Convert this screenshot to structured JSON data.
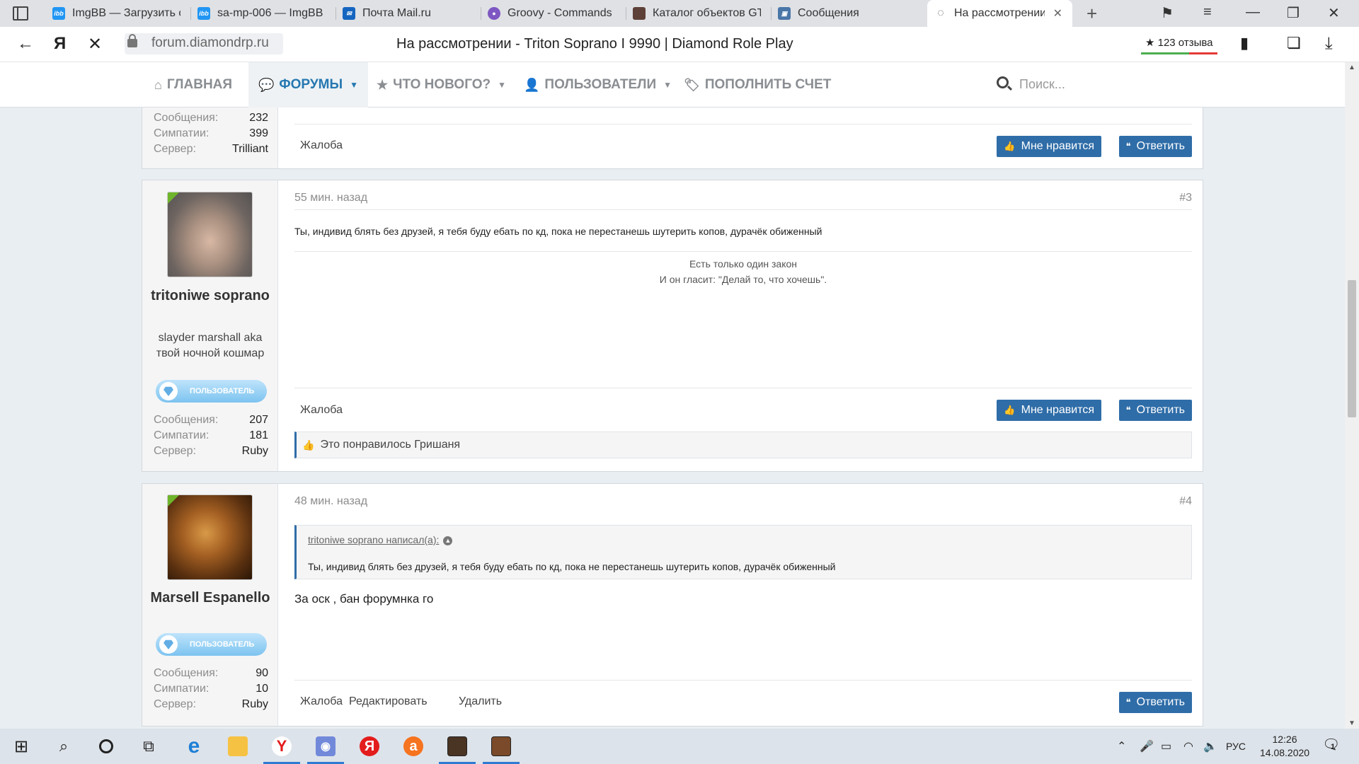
{
  "browser": {
    "tabs": [
      {
        "title": "ImgBB — Загрузить с",
        "icon": "imgbb-icon",
        "color": "#2196f3",
        "short": "ibb"
      },
      {
        "title": "sa-mp-006 — ImgBB",
        "icon": "imgbb-icon",
        "color": "#2196f3",
        "short": "ibb"
      },
      {
        "title": "Почта Mail.ru",
        "icon": "mail-icon",
        "color": "#1565c0",
        "short": "✉"
      },
      {
        "title": "Groovy - Commands",
        "icon": "discord-icon",
        "color": "#7e57c2",
        "short": "●"
      },
      {
        "title": "Каталог объектов GT",
        "icon": "catalog-icon",
        "color": "#5d4037",
        "short": ""
      },
      {
        "title": "Сообщения",
        "icon": "vk-icon",
        "color": "#4a76a8",
        "short": "▣"
      },
      {
        "title": "На рассмотрении",
        "icon": "loading-icon",
        "color": "#ffffff",
        "short": "◌"
      }
    ],
    "url": "forum.diamondrp.ru",
    "page_title": "На рассмотрении - Triton Soprano I 9990 | Diamond Role Play",
    "reviews": "★ 123 отзыва"
  },
  "nav": {
    "home": "ГЛАВНАЯ",
    "forums": "ФОРУМЫ",
    "whats_new": "ЧТО НОВОГО?",
    "users": "ПОЛЬЗОВАТЕЛИ",
    "topup": "ПОПОЛНИТЬ СЧЕТ",
    "search_placeholder": "Поиск..."
  },
  "labels": {
    "messages": "Сообщения:",
    "likes": "Симпатии:",
    "server": "Сервер:",
    "report": "Жалоба",
    "like": "Мне нравится",
    "reply": "Ответить",
    "edit": "Редактировать",
    "delete": "Удалить"
  },
  "posts": {
    "prev": {
      "messages": "232",
      "likes": "399",
      "server": "Trilliant"
    },
    "p3": {
      "username": "tritoniwe soprano",
      "user_title": "slayder marshall aka твой ночной кошмар",
      "badge": "ПОЛЬЗОВАТЕЛЬ",
      "messages": "207",
      "likes": "181",
      "server": "Ruby",
      "time": "55 мин. назад",
      "num": "#3",
      "text": "Ты, индивид блять без друзей, я тебя буду ебать по кд, пока не перестанешь шутерить копов, дурачёк обиженный",
      "sig_line1": "Есть только один закон",
      "sig_line2": "И он гласит: \"Делай то, что хочешь\".",
      "liked_by": "Это понравилось Гришаня"
    },
    "p4": {
      "username": "Marsell Espanello",
      "badge": "ПОЛЬЗОВАТЕЛЬ",
      "messages": "90",
      "likes": "10",
      "server": "Ruby",
      "time": "48 мин. назад",
      "num": "#4",
      "quote_author": "tritoniwe soprano написал(а):",
      "quote_text": "Ты, индивид блять без друзей, я тебя буду ебать по кд, пока не перестанешь шутерить копов, дурачёк обиженный",
      "text": "За оск , бан форумнка го"
    }
  },
  "taskbar": {
    "lang": "РУС",
    "time": "12:26",
    "date": "14.08.2020",
    "notifications": "1"
  }
}
